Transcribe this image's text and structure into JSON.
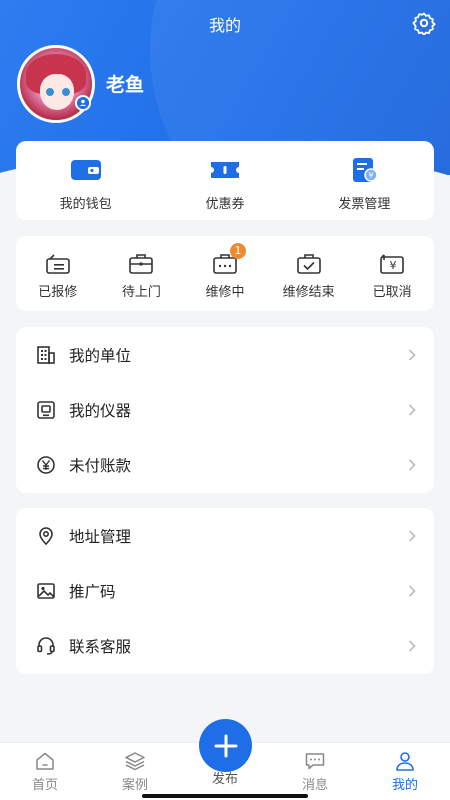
{
  "header": {
    "title": "我的"
  },
  "user": {
    "name": "老鱼"
  },
  "wallet": {
    "items": [
      {
        "label": "我的钱包",
        "icon": "wallet-icon"
      },
      {
        "label": "优惠券",
        "icon": "coupon-icon"
      },
      {
        "label": "发票管理",
        "icon": "invoice-icon"
      }
    ]
  },
  "orders": {
    "items": [
      {
        "label": "已报修",
        "icon": "reported-icon"
      },
      {
        "label": "待上门",
        "icon": "pending-visit-icon"
      },
      {
        "label": "维修中",
        "icon": "repairing-icon",
        "badge": "1"
      },
      {
        "label": "维修结束",
        "icon": "repair-done-icon"
      },
      {
        "label": "已取消",
        "icon": "cancelled-icon"
      }
    ]
  },
  "menu1": [
    {
      "label": "我的单位",
      "icon": "building-icon"
    },
    {
      "label": "我的仪器",
      "icon": "instrument-icon"
    },
    {
      "label": "未付账款",
      "icon": "yen-icon"
    }
  ],
  "menu2": [
    {
      "label": "地址管理",
      "icon": "location-icon"
    },
    {
      "label": "推广码",
      "icon": "image-icon"
    },
    {
      "label": "联系客服",
      "icon": "headset-icon"
    }
  ],
  "tabbar": {
    "items": [
      {
        "label": "首页",
        "icon": "home-icon"
      },
      {
        "label": "案例",
        "icon": "layers-icon"
      },
      {
        "label": "发布",
        "icon": "plus-icon"
      },
      {
        "label": "消息",
        "icon": "message-icon"
      },
      {
        "label": "我的",
        "icon": "profile-icon"
      }
    ]
  },
  "colors": {
    "primary": "#1e6ee8",
    "badge": "#f08a2f",
    "background": "#f4f5f7"
  }
}
